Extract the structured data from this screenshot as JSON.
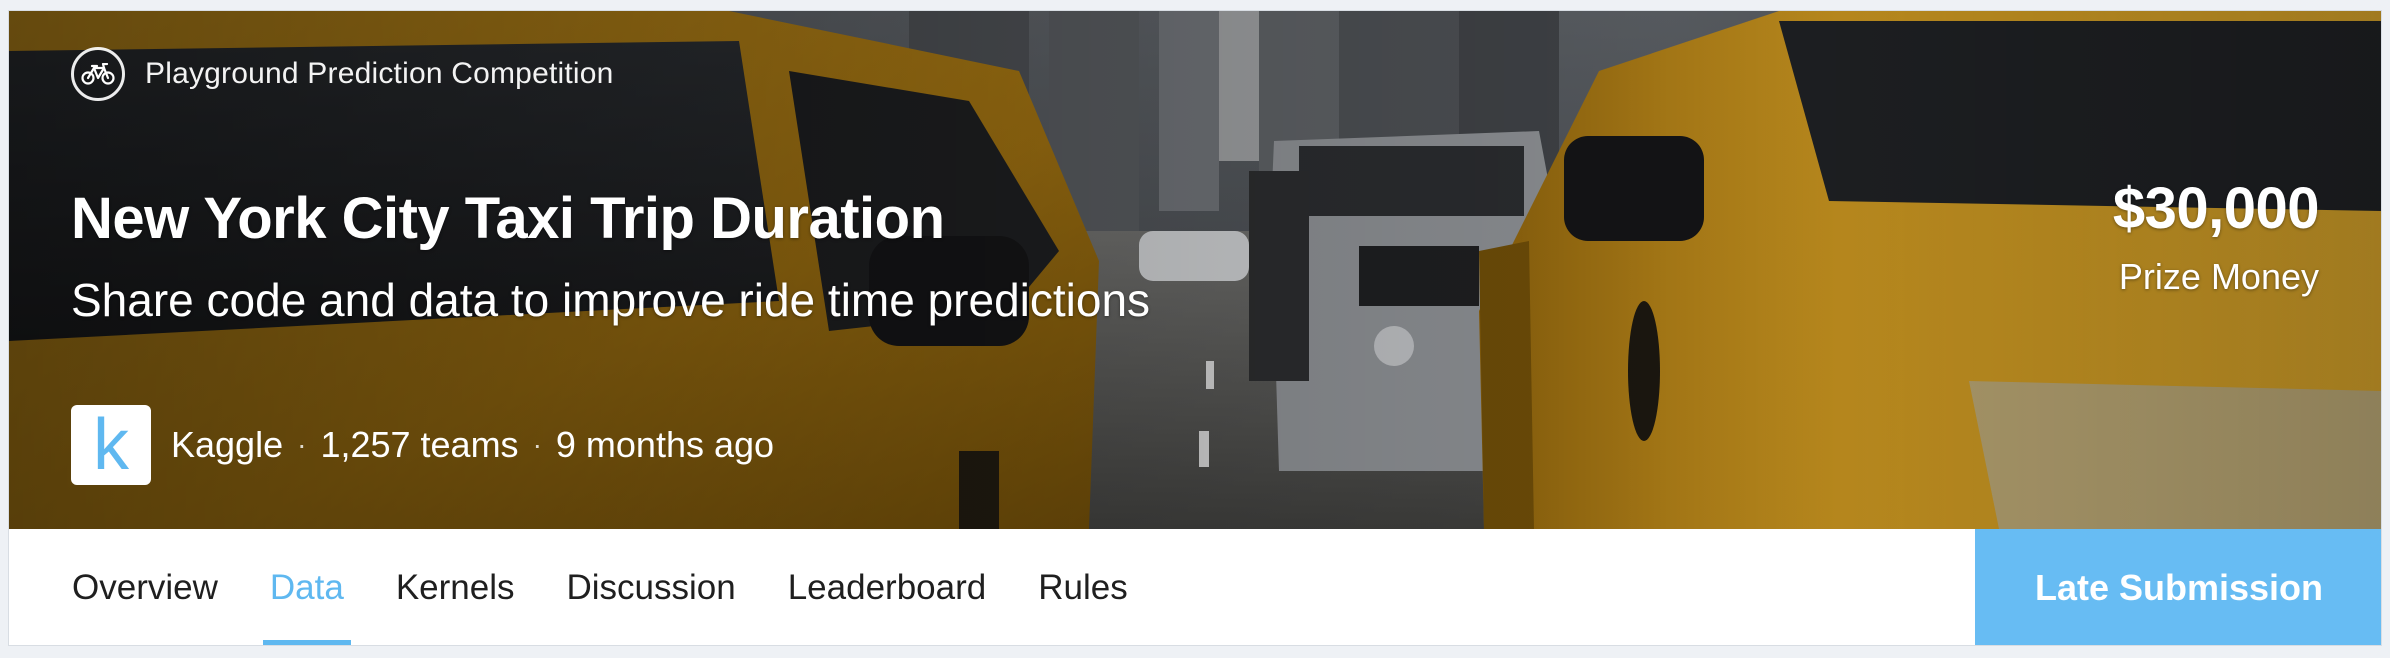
{
  "hero": {
    "competition_type": "Playground Prediction Competition",
    "competition_icon": "bicycle-icon",
    "title": "New York City Taxi Trip Duration",
    "subtitle": "Share code and data to improve ride time predictions",
    "host": {
      "logo_letter": "k",
      "name": "Kaggle",
      "teams": "1,257 teams",
      "time": "9 months ago",
      "separator": "·"
    },
    "prize": {
      "amount": "$30,000",
      "caption": "Prize Money"
    }
  },
  "tabs": [
    {
      "label": "Overview",
      "active": false
    },
    {
      "label": "Data",
      "active": true
    },
    {
      "label": "Kernels",
      "active": false
    },
    {
      "label": "Discussion",
      "active": false
    },
    {
      "label": "Leaderboard",
      "active": false
    },
    {
      "label": "Rules",
      "active": false
    }
  ],
  "actions": {
    "late_submission": "Late Submission"
  },
  "colors": {
    "accent": "#5fb8f0",
    "button": "#67bcf3",
    "taxi_yellow": "#c9951c"
  }
}
